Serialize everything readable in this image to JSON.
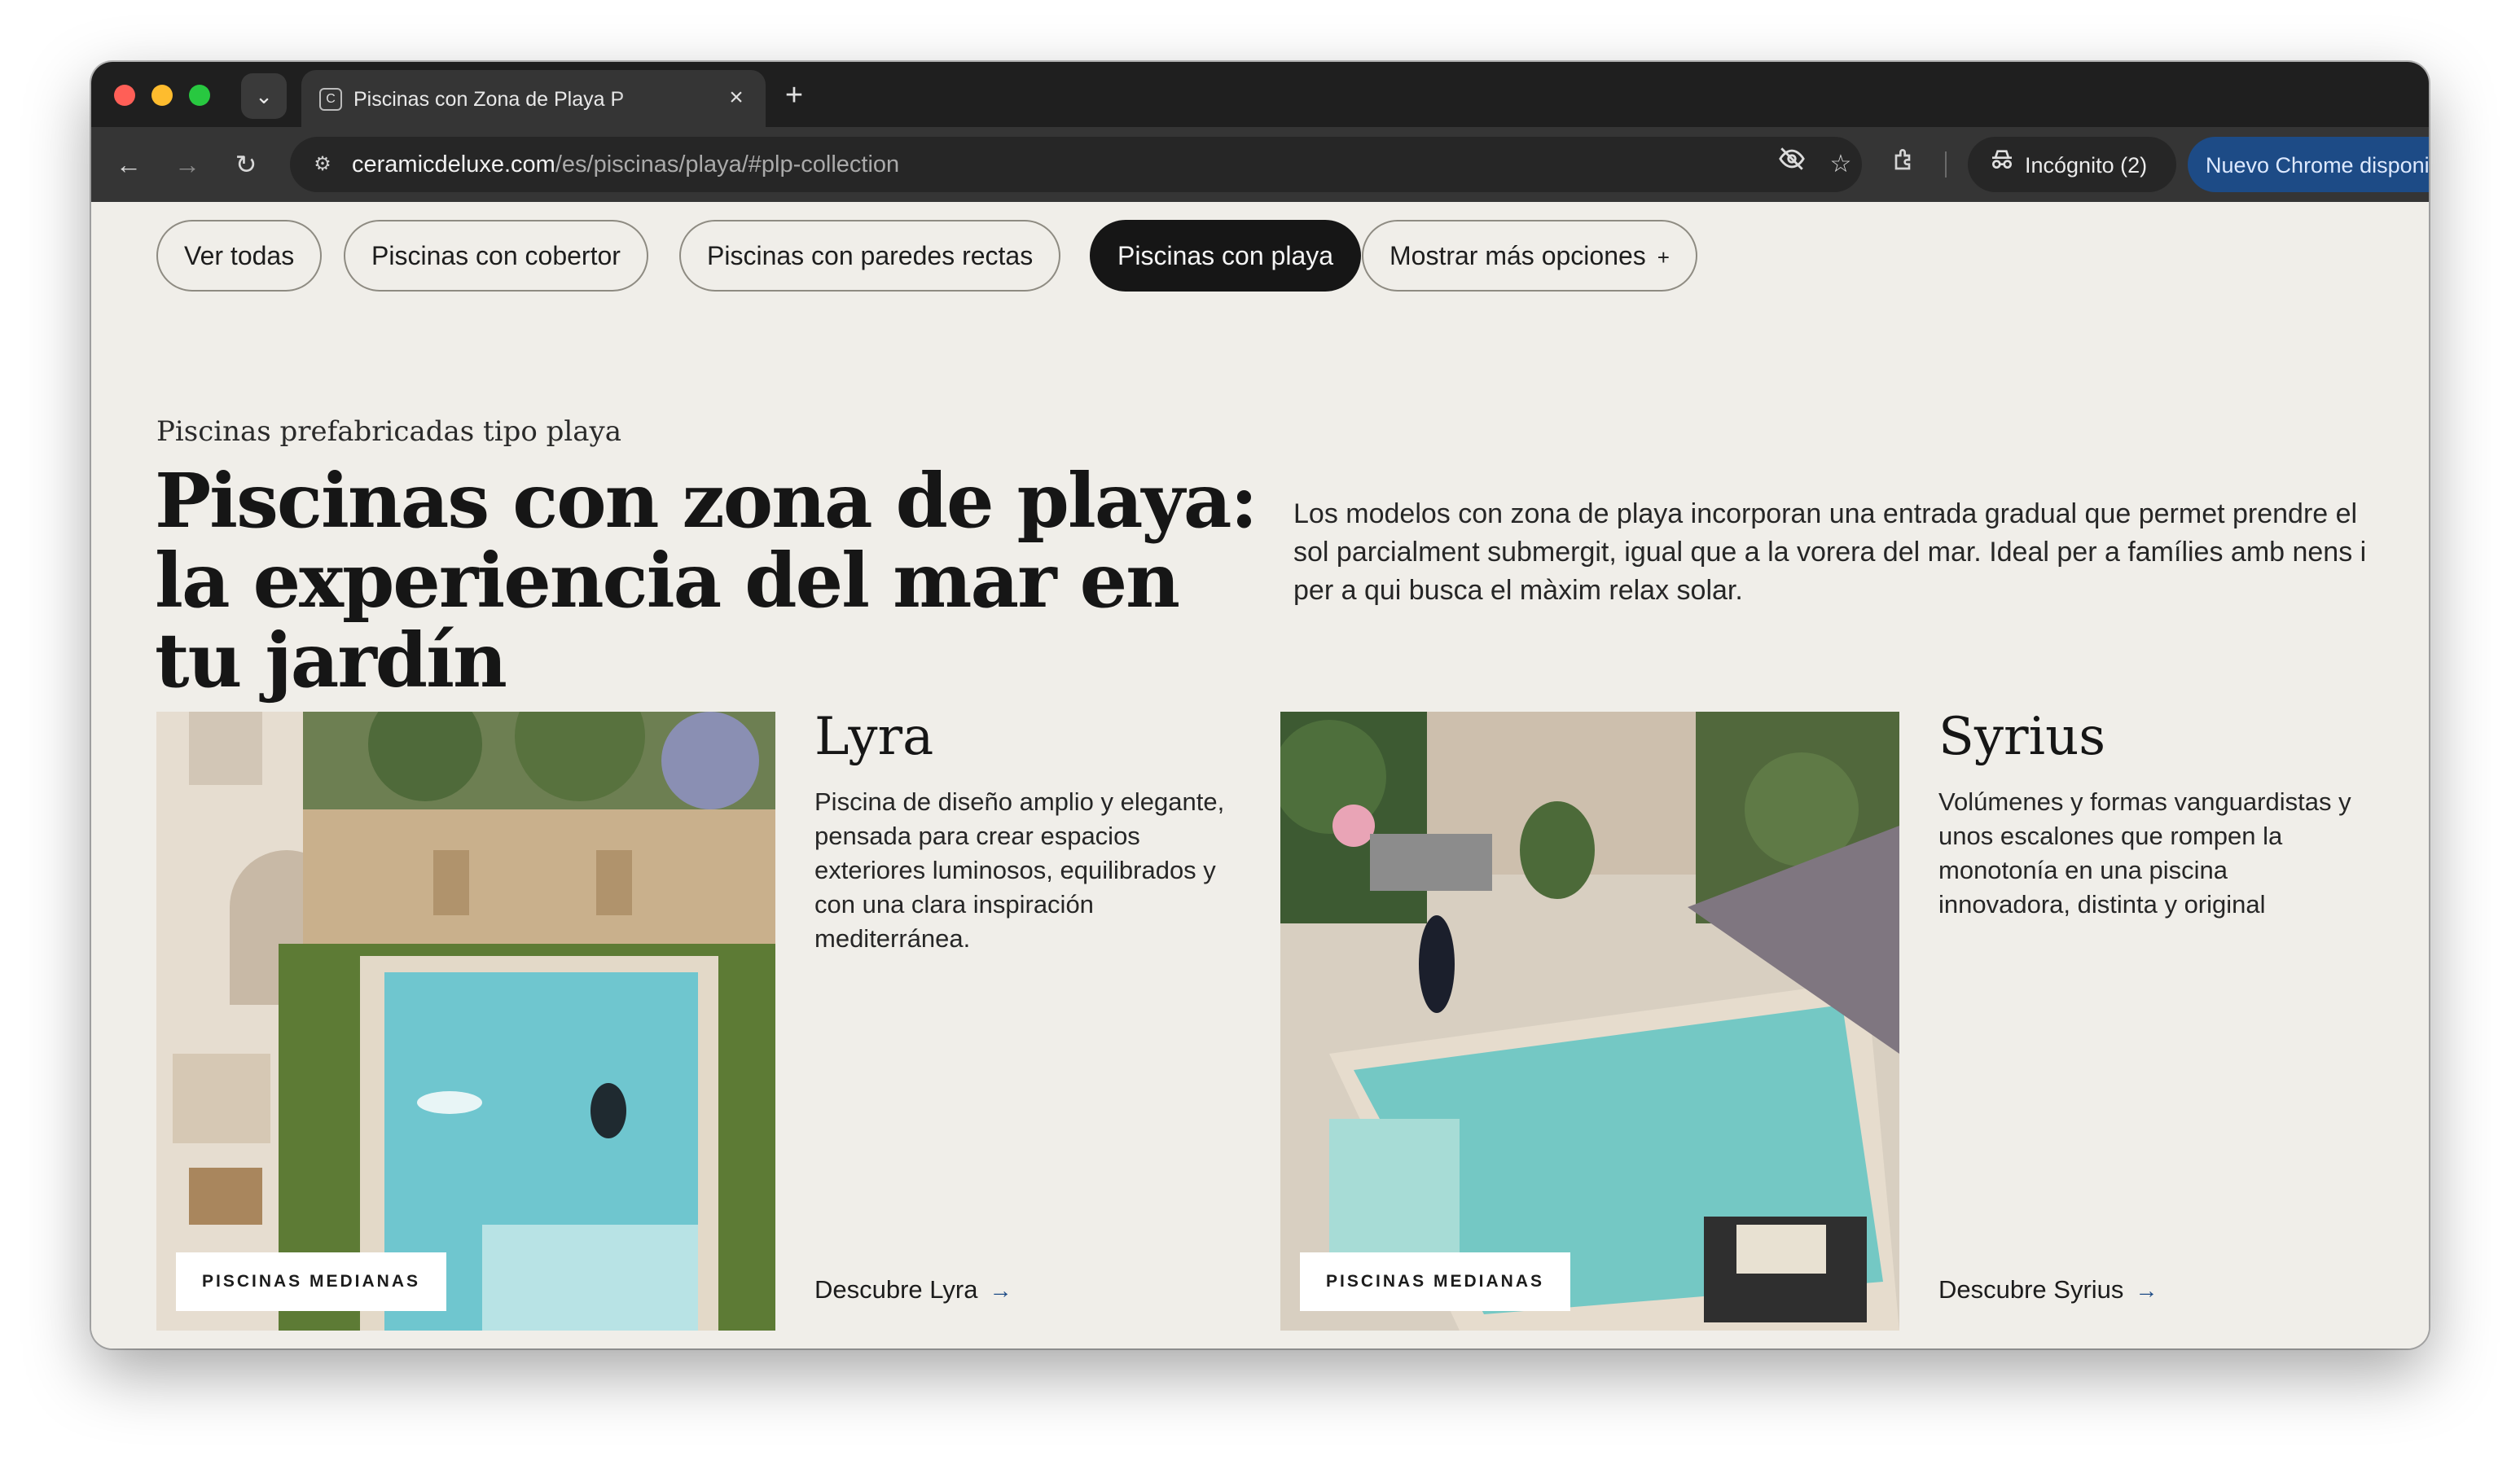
{
  "browser": {
    "tab_title": "Piscinas con Zona de Playa P",
    "url_host": "ceramicdeluxe.com",
    "url_path": "/es/piscinas/playa/#plp-collection",
    "incognito_label": "Incógnito (2)",
    "update_label": "Nuevo Chrome disponible"
  },
  "filters": [
    {
      "label": "Ver todas",
      "active": false
    },
    {
      "label": "Piscinas con cobertor",
      "active": false
    },
    {
      "label": "Piscinas con paredes rectas",
      "active": false
    },
    {
      "label": "Piscinas con playa",
      "active": true
    },
    {
      "label": "Mostrar más opciones",
      "active": false
    }
  ],
  "hero": {
    "eyebrow": "Piscinas prefabricadas tipo playa",
    "headline": "Piscinas con zona de playa: la experiencia del mar en tu jardín",
    "intro": "Los modelos con zona de playa incorporan una entrada gradual que permet prendre el sol parcialment submergit, igual que a la vorera del mar. Ideal per a famílies amb nens i per a qui busca el màxim relax solar."
  },
  "products": [
    {
      "name": "Lyra",
      "badge": "PISCINAS MEDIANAS",
      "description": "Piscina de diseño amplio y elegante, pensada para crear espacios exteriores luminosos, equilibrados y con una clara inspiración mediterránea.",
      "link": "Descubre Lyra"
    },
    {
      "name": "Syrius",
      "badge": "PISCINAS MEDIANAS",
      "description": "Volúmenes y formas vanguardistas y unos escalones que rompen la monotonía en una piscina innovadora, distinta y original",
      "link": "Descubre Syrius"
    }
  ],
  "colors": {
    "page_bg": "#f0eee9",
    "active_chip": "#161616",
    "chrome_dark": "#1f1f1f",
    "update_pill": "#1d4b86",
    "pool_water": "#6fc6cf"
  }
}
